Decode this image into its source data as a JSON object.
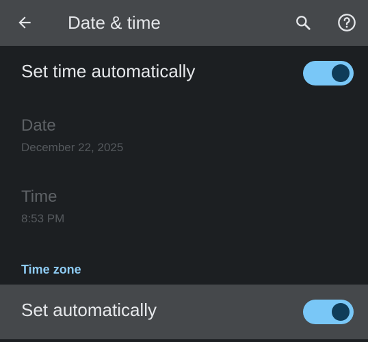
{
  "app_bar": {
    "title": "Date & time",
    "back_icon": "arrow-left-icon",
    "search_icon": "search-icon",
    "help_icon": "help-circle-icon"
  },
  "settings": {
    "set_time_automatically": {
      "label": "Set time automatically",
      "enabled": true
    },
    "date": {
      "title": "Date",
      "value": "December 22, 2025"
    },
    "time": {
      "title": "Time",
      "value": "8:53 PM"
    }
  },
  "time_zone": {
    "section_title": "Time zone",
    "set_automatically": {
      "label": "Set automatically",
      "enabled": true
    }
  },
  "colors": {
    "app_bar_bg": "#45484b",
    "page_bg": "#1c1f22",
    "accent": "#8ecbf3",
    "toggle_track": "#79c7f7",
    "toggle_thumb": "#0f3c59"
  }
}
